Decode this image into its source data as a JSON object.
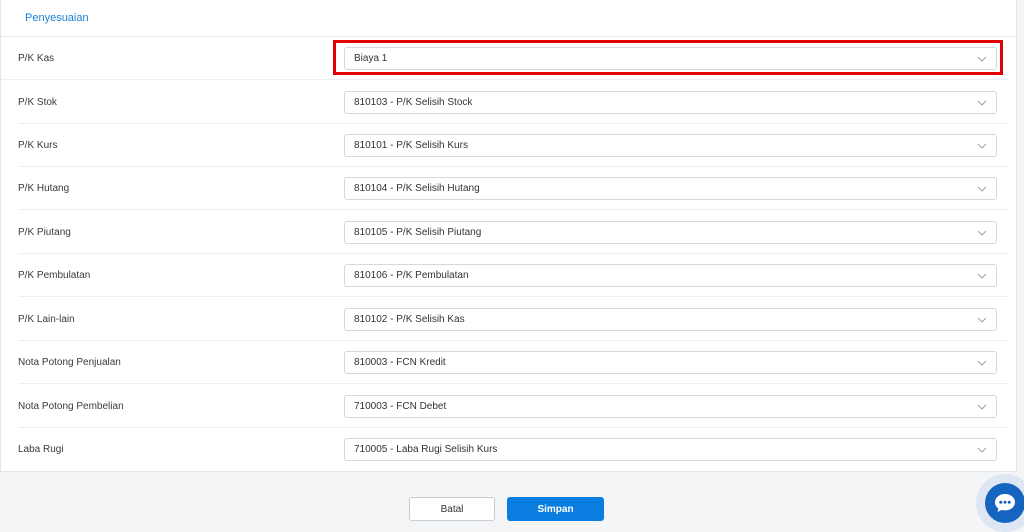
{
  "section": {
    "title": "Penyesuaian"
  },
  "fields": [
    {
      "label": "P/K Kas",
      "value": "Biaya 1"
    },
    {
      "label": "P/K Stok",
      "value": "810103 - P/K Selisih Stock"
    },
    {
      "label": "P/K Kurs",
      "value": "810101 - P/K Selisih Kurs"
    },
    {
      "label": "P/K Hutang",
      "value": "810104 - P/K Selisih Hutang"
    },
    {
      "label": "P/K Piutang",
      "value": "810105 - P/K Selisih Piutang"
    },
    {
      "label": "P/K Pembulatan",
      "value": "810106 - P/K Pembulatan"
    },
    {
      "label": "P/K Lain-lain",
      "value": "810102 - P/K Selisih Kas"
    },
    {
      "label": "Nota Potong Penjualan",
      "value": "810003 - FCN Kredit"
    },
    {
      "label": "Nota Potong Pembelian",
      "value": "710003 - FCN Debet"
    },
    {
      "label": "Laba Rugi",
      "value": "710005 - Laba Rugi Selisih Kurs"
    }
  ],
  "actions": {
    "cancel_label": "Batal",
    "save_label": "Simpan"
  },
  "colors": {
    "accent": "#0a7ee0",
    "highlight": "#e00000"
  },
  "icons": {
    "select_toggle": "chevron-down-icon",
    "chat": "chat-bubble-icon"
  }
}
